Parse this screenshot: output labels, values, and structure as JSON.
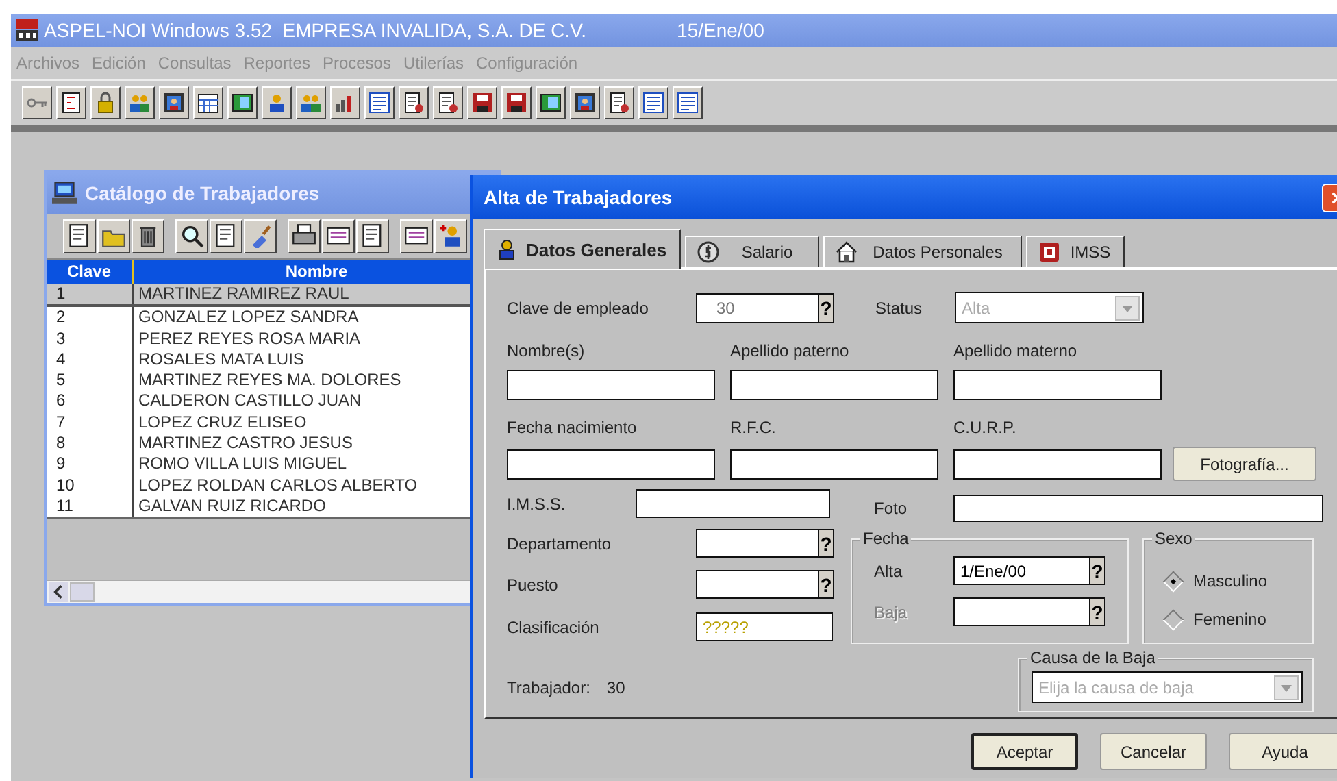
{
  "window": {
    "title": "ASPEL-NOI Windows 3.52  EMPRESA INVALIDA, S.A. DE C.V.",
    "date": "15/Ene/00"
  },
  "menu": [
    "Archivos",
    "Edición",
    "Consultas",
    "Reportes",
    "Procesos",
    "Utilerías",
    "Configuración"
  ],
  "catalog": {
    "title": "Catálogo de Trabajadores",
    "columns": [
      "Clave",
      "Nombre"
    ],
    "rows": [
      {
        "clave": "1",
        "nombre": "MARTINEZ RAMIREZ RAUL",
        "selected": true
      },
      {
        "clave": "2",
        "nombre": "GONZALEZ LOPEZ SANDRA",
        "selected": false
      },
      {
        "clave": "3",
        "nombre": "PEREZ REYES ROSA MARIA",
        "selected": false
      },
      {
        "clave": "4",
        "nombre": "ROSALES MATA LUIS",
        "selected": false
      },
      {
        "clave": "5",
        "nombre": "MARTINEZ REYES MA. DOLORES",
        "selected": false
      },
      {
        "clave": "6",
        "nombre": "CALDERON CASTILLO JUAN",
        "selected": false
      },
      {
        "clave": "7",
        "nombre": "LOPEZ CRUZ ELISEO",
        "selected": false
      },
      {
        "clave": "8",
        "nombre": "MARTINEZ CASTRO JESUS",
        "selected": false
      },
      {
        "clave": "9",
        "nombre": "ROMO VILLA LUIS MIGUEL",
        "selected": false
      },
      {
        "clave": "10",
        "nombre": "LOPEZ ROLDAN CARLOS ALBERTO",
        "selected": false
      },
      {
        "clave": "11",
        "nombre": "GALVAN RUIZ RICARDO",
        "selected": false
      }
    ]
  },
  "dialog": {
    "title": "Alta de Trabajadores",
    "tabs": [
      {
        "label": "Datos Generales",
        "selected": true
      },
      {
        "label": "Salario",
        "selected": false
      },
      {
        "label": "Datos Personales",
        "selected": false
      },
      {
        "label": "IMSS",
        "selected": false
      }
    ],
    "clave": {
      "label": "Clave de empleado",
      "value": "30",
      "lookup": "?",
      "disabled": true
    },
    "status": {
      "label": "Status",
      "value": "Alta",
      "disabled": true
    },
    "names": [
      {
        "label": "Nombre(s)"
      },
      {
        "label": "Apellido paterno"
      },
      {
        "label": "Apellido materno"
      }
    ],
    "ids": [
      {
        "label": "Fecha nacimiento"
      },
      {
        "label": "R.F.C."
      },
      {
        "label": "C.U.R.P."
      }
    ],
    "photo_button": "Fotografía...",
    "imss": {
      "label": "I.M.S.S."
    },
    "foto": {
      "label": "Foto"
    },
    "left_fields": [
      {
        "label": "Departamento",
        "lookup": "?"
      },
      {
        "label": "Puesto",
        "lookup": "?"
      },
      {
        "label": "Clasificación",
        "value": "?????"
      }
    ],
    "fecha": {
      "title": "Fecha",
      "fields": [
        {
          "label": "Alta",
          "value": "1/Ene/00",
          "lookup": "?",
          "disabled": false
        },
        {
          "label": "Baja",
          "lookup": "?",
          "disabled": true
        }
      ]
    },
    "sexo": {
      "title": "Sexo",
      "options": [
        {
          "label": "Masculino",
          "selected": true
        },
        {
          "label": "Femenino",
          "selected": false
        }
      ]
    },
    "causa": {
      "title": "Causa de la Baja",
      "placeholder": "Elija la causa de baja",
      "disabled": true
    },
    "trabajador": {
      "label": "Trabajador:",
      "value": "30"
    },
    "buttons": [
      {
        "label": "Aceptar",
        "default": true
      },
      {
        "label": "Cancelar",
        "default": false
      },
      {
        "label": "Ayuda",
        "default": false
      }
    ]
  }
}
